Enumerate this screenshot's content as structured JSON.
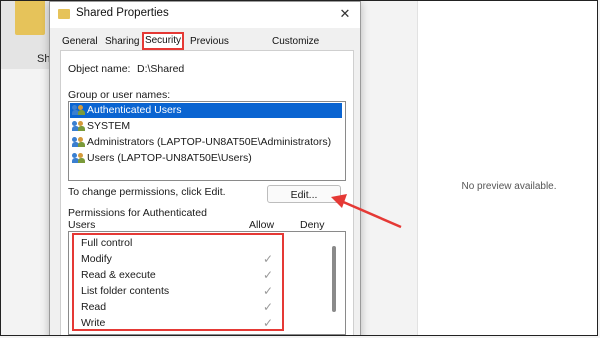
{
  "background": {
    "left_label": "Sh",
    "preview_text": "No preview available."
  },
  "dialog": {
    "title": "Shared Properties",
    "tabs": [
      "General",
      "Sharing",
      "Security",
      "Previous Versions",
      "Customize"
    ],
    "active_tab": "Security",
    "object_name_label": "Object name:",
    "object_name_value": "D:\\Shared",
    "group_label": "Group or user names:",
    "users": [
      {
        "label": "Authenticated Users",
        "selected": true
      },
      {
        "label": "SYSTEM",
        "selected": false
      },
      {
        "label": "Administrators (LAPTOP-UN8AT50E\\Administrators)",
        "selected": false
      },
      {
        "label": "Users (LAPTOP-UN8AT50E\\Users)",
        "selected": false
      }
    ],
    "change_text": "To change permissions, click Edit.",
    "edit_label": "Edit...",
    "permissions_heading_1": "Permissions for Authenticated",
    "permissions_heading_2": "Users",
    "allow_label": "Allow",
    "deny_label": "Deny",
    "permissions": [
      {
        "label": "Full control",
        "allow": false
      },
      {
        "label": "Modify",
        "allow": true
      },
      {
        "label": "Read & execute",
        "allow": true
      },
      {
        "label": "List folder contents",
        "allow": true
      },
      {
        "label": "Read",
        "allow": true
      },
      {
        "label": "Write",
        "allow": true
      }
    ],
    "check_glyph": "✓",
    "close_glyph": "✕"
  },
  "colors": {
    "highlight": "#e53935",
    "selection": "#0a64d1"
  }
}
